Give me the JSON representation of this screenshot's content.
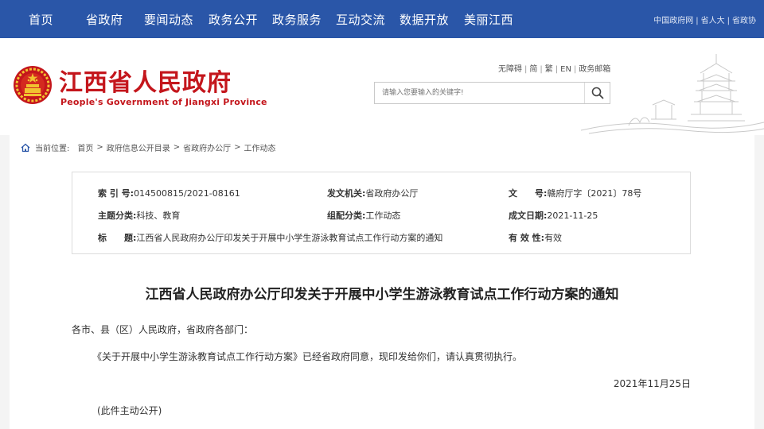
{
  "topnav": {
    "items": [
      "首页",
      "省政府",
      "要闻动态",
      "政务公开",
      "政务服务",
      "互动交流",
      "数据开放",
      "美丽江西"
    ],
    "external_links": [
      "中国政府网",
      "省人大",
      "省政协"
    ]
  },
  "header": {
    "title_cn": "江西省人民政府",
    "title_en": "People's Government of Jiangxi Province",
    "utility_links": [
      "无障碍",
      "简",
      "繁",
      "EN",
      "政务邮箱"
    ],
    "search_placeholder": "请输入您要输入的关键字!"
  },
  "breadcrumb": {
    "label": "当前位置:",
    "items": [
      "首页",
      "政府信息公开目录",
      "省政府办公厅",
      "工作动态"
    ]
  },
  "meta": {
    "index_no_label": "索 引 号:",
    "index_no": "014500815/2021-08161",
    "issuer_label": "发文机关:",
    "issuer": "省政府办公厅",
    "doc_no_label": "文　　号:",
    "doc_no": "赣府厅字〔2021〕78号",
    "topic_label": "主题分类:",
    "topic": "科技、教育",
    "category_label": "组配分类:",
    "category": "工作动态",
    "date_label": "成文日期:",
    "date": "2021-11-25",
    "subject_label": "标　　题:",
    "subject": "江西省人民政府办公厅印发关于开展中小学生游泳教育试点工作行动方案的通知",
    "validity_label": "有 效 性:",
    "validity": "有效"
  },
  "article": {
    "title": "江西省人民政府办公厅印发关于开展中小学生游泳教育试点工作行动方案的通知",
    "salutation": "各市、县（区）人民政府，省政府各部门：",
    "body": "《关于开展中小学生游泳教育试点工作行动方案》已经省政府同意，现印发给你们，请认真贯彻执行。",
    "sign_date": "2021年11月25日",
    "note": "(此件主动公开)"
  },
  "colors": {
    "nav_bg": "#2a56a8",
    "brand_red": "#c4161c",
    "emblem_gold": "#f2c230"
  }
}
